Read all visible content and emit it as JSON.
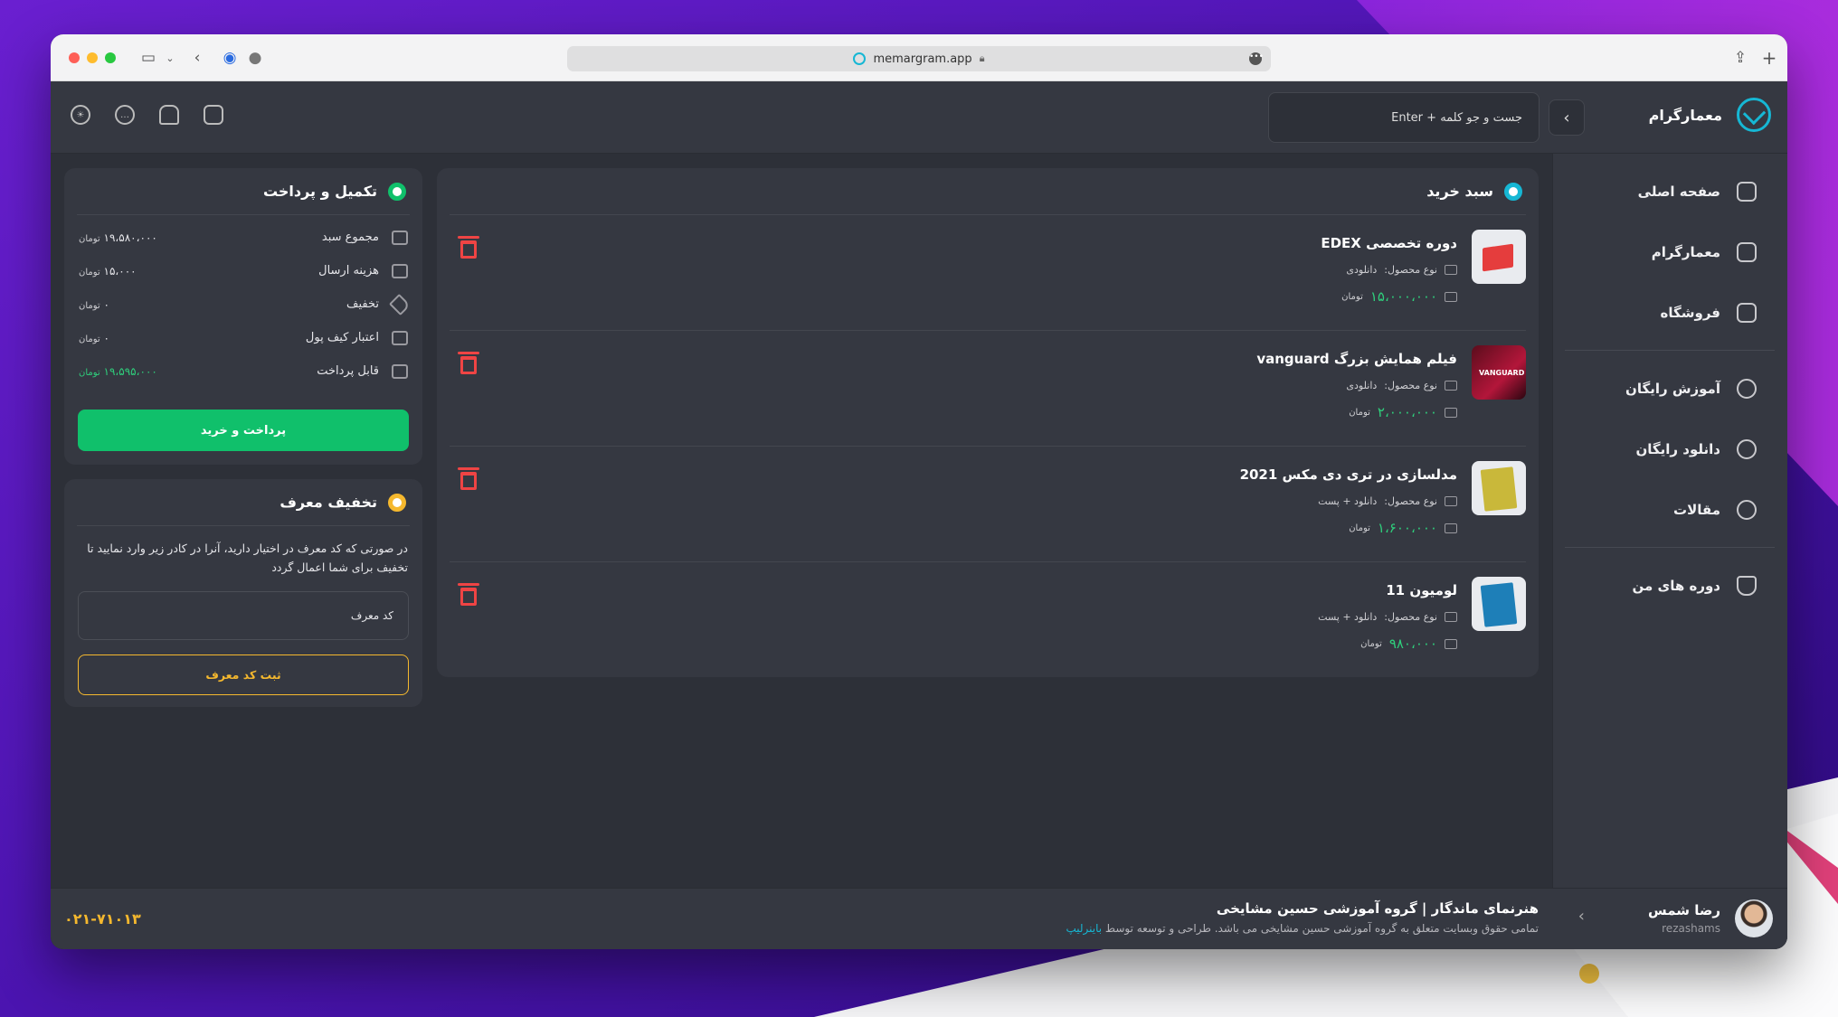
{
  "browser": {
    "url": "memargram.app"
  },
  "header": {
    "brand": "معمارگرام",
    "search_placeholder": "جست و جو کلمه + Enter"
  },
  "sidebar": {
    "items": [
      {
        "label": "صفحه اصلی",
        "icon": "grid-icon"
      },
      {
        "label": "معمارگرام",
        "icon": "camera-icon"
      },
      {
        "label": "فروشگاه",
        "icon": "bag-icon"
      },
      {
        "label": "آموزش رایگان",
        "icon": "play-icon"
      },
      {
        "label": "دانلود رایگان",
        "icon": "download-icon"
      },
      {
        "label": "مقالات",
        "icon": "article-icon"
      },
      {
        "label": "دوره های من",
        "icon": "graduation-icon"
      }
    ]
  },
  "cart": {
    "title": "سبد خرید",
    "type_label": "نوع محصول:",
    "currency": "تومان",
    "items": [
      {
        "title": "دوره تخصصی EDEX",
        "type": "دانلودی",
        "price": "۱۵،۰۰۰،۰۰۰"
      },
      {
        "title": "فیلم همایش بزرگ vanguard",
        "type": "دانلودی",
        "price": "۲،۰۰۰،۰۰۰"
      },
      {
        "title": "مدلسازی در تری دی مکس 2021",
        "type": "دانلود + پست",
        "price": "۱،۶۰۰،۰۰۰"
      },
      {
        "title": "لومیون 11",
        "type": "دانلود + پست",
        "price": "۹۸۰،۰۰۰"
      }
    ]
  },
  "payment": {
    "title": "تکمیل و پرداخت",
    "currency": "تومان",
    "rows": [
      {
        "label": "مجموع سبد",
        "value": "۱۹،۵۸۰،۰۰۰"
      },
      {
        "label": "هزینه ارسال",
        "value": "۱۵،۰۰۰"
      },
      {
        "label": "تخفیف",
        "value": "۰"
      },
      {
        "label": "اعتبار کیف پول",
        "value": "۰"
      },
      {
        "label": "قابل پرداخت",
        "value": "۱۹،۵۹۵،۰۰۰"
      }
    ],
    "button": "پرداخت و خرید"
  },
  "referral": {
    "title": "تخفیف معرف",
    "description": "در صورتی که کد معرف در اختیار دارید، آنرا در کادر زیر وارد نمایید تا تخفیف برای شما اعمال گردد",
    "placeholder": "کد معرف",
    "button": "ثبت کد معرف"
  },
  "user": {
    "name": "رضا شمس",
    "handle": "rezashams"
  },
  "footer": {
    "title": "هنرنمای ماندگار | گروه آموزشی حسین مشایخی",
    "copyright": "تمامی حقوق وبسایت متعلق به گروه آموزشی حسین مشایخی می باشد. طراحی و توسعه توسط",
    "dev_link": "باینرلیپ",
    "phone": "۰۲۱-۷۱۰۱۳"
  },
  "colors": {
    "accent": "#16b7d4",
    "green": "#10c06b",
    "yellow": "#f5b82e",
    "danger": "#ef4444"
  }
}
